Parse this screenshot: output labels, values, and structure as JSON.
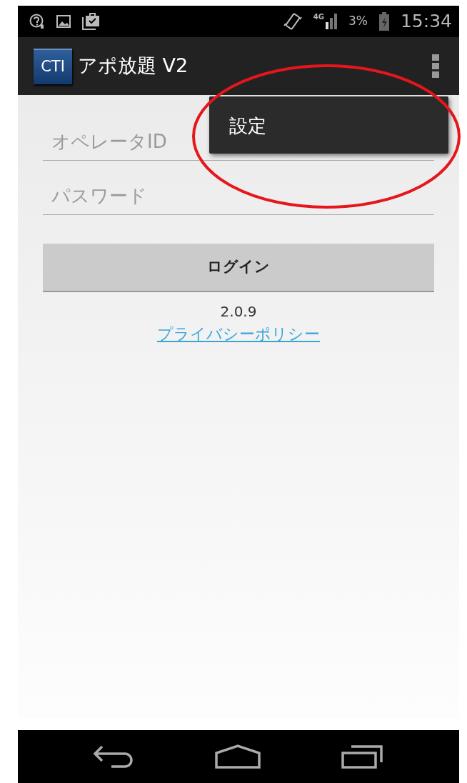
{
  "status_bar": {
    "network": "4G",
    "battery": "3%",
    "time": "15:34"
  },
  "app_bar": {
    "logo": "CTI",
    "title": "アポ放題 V2"
  },
  "overflow_menu": {
    "items": [
      {
        "label": "設定"
      }
    ]
  },
  "form": {
    "fields": [
      {
        "placeholder": "オペレータID"
      },
      {
        "placeholder": "パスワード"
      }
    ],
    "login_button": "ログイン",
    "version": "2.0.9",
    "privacy_link": "プライバシーポリシー"
  }
}
